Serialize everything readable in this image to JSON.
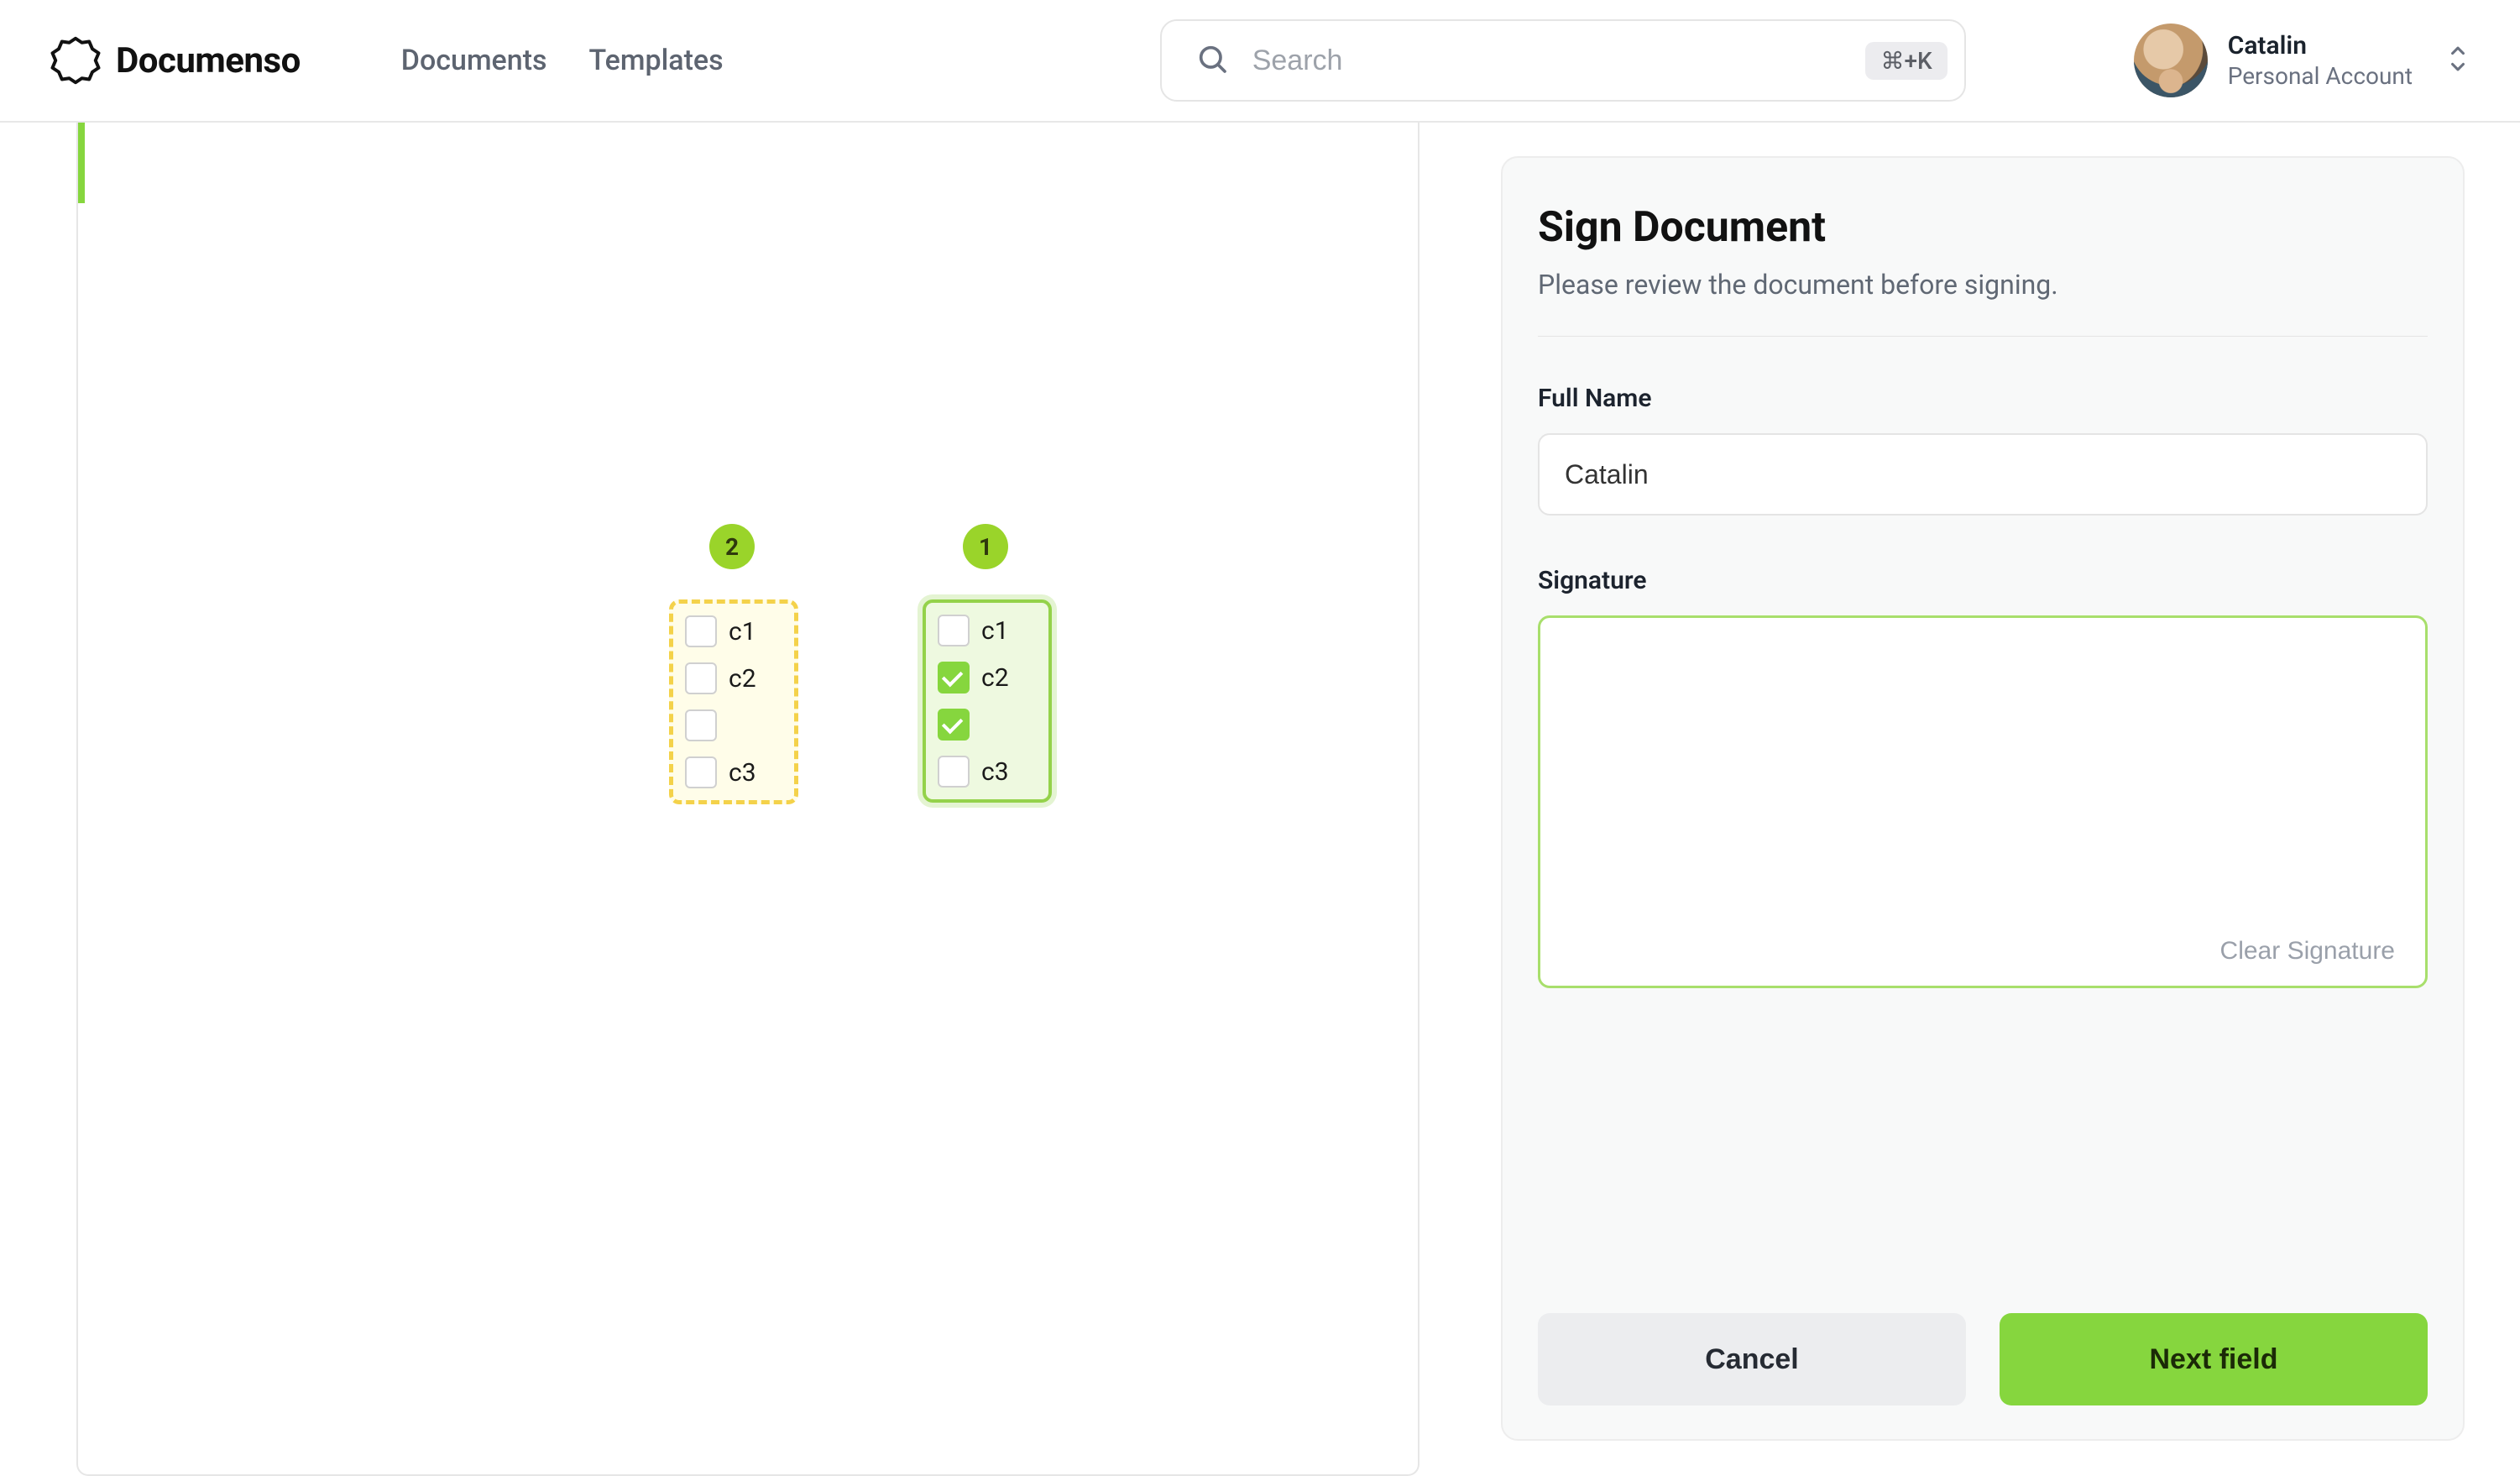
{
  "header": {
    "brand": "Documenso",
    "nav": {
      "documents": "Documents",
      "templates": "Templates"
    },
    "search": {
      "placeholder": "Search",
      "shortcut": "⌘+K"
    },
    "user": {
      "name": "Catalin",
      "account_type": "Personal Account"
    }
  },
  "document": {
    "badges": {
      "left": "2",
      "right": "1"
    },
    "yellow_field": {
      "items": [
        {
          "label": "c1",
          "checked": false
        },
        {
          "label": "c2",
          "checked": false
        },
        {
          "label": "",
          "checked": false
        },
        {
          "label": "c3",
          "checked": false
        }
      ]
    },
    "green_field": {
      "items": [
        {
          "label": "c1",
          "checked": false
        },
        {
          "label": "c2",
          "checked": true
        },
        {
          "label": "",
          "checked": true
        },
        {
          "label": "c3",
          "checked": false
        }
      ]
    }
  },
  "panel": {
    "title": "Sign Document",
    "subtitle": "Please review the document before signing.",
    "full_name_label": "Full Name",
    "full_name_value": "Catalin",
    "signature_label": "Signature",
    "clear_signature": "Clear Signature",
    "cancel": "Cancel",
    "next": "Next field"
  },
  "colors": {
    "accent_green": "#86d63e",
    "accent_yellow": "#f4d24a"
  }
}
